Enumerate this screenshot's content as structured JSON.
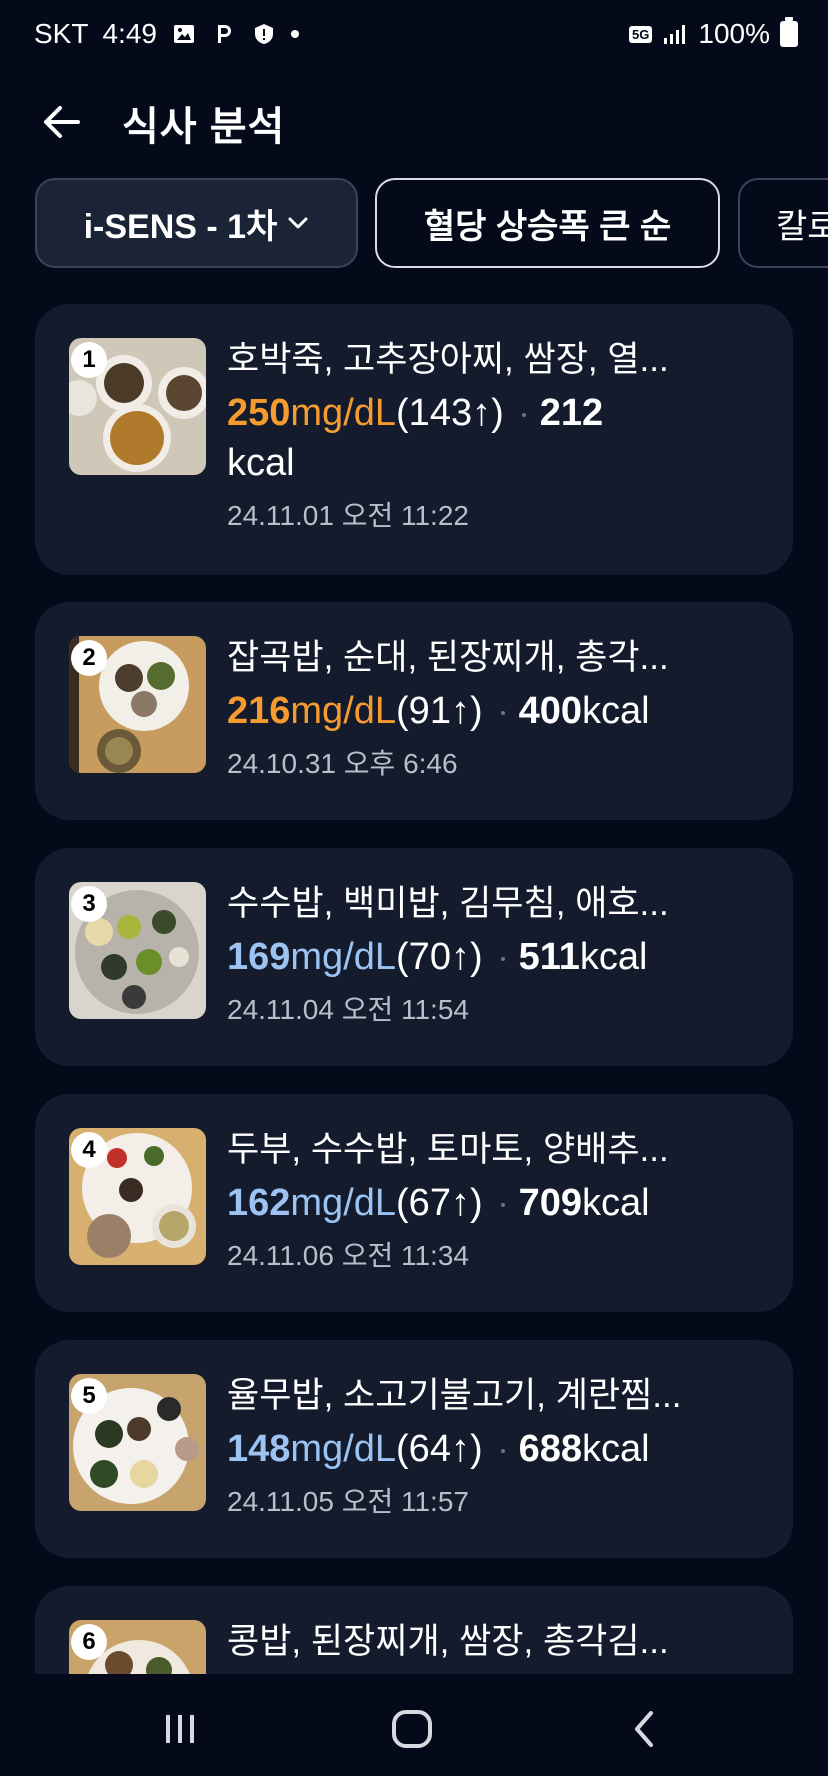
{
  "status": {
    "carrier": "SKT",
    "time": "4:49",
    "network": "5G",
    "battery": "100%",
    "icons": [
      "image-icon",
      "p-icon",
      "shield-icon",
      "dot-icon",
      "signal-icon",
      "battery-icon"
    ]
  },
  "header": {
    "title": "식사 분석"
  },
  "filters": {
    "device": "i-SENS - 1차",
    "sort": "혈당 상승폭 큰 순",
    "third": "칼로"
  },
  "colors": {
    "high": "#f59b2f",
    "normal": "#9cc3f2",
    "background": "#050a1b",
    "card": "#131b2c"
  },
  "meals": [
    {
      "rank": "1",
      "foods": "호박죽, 고추장아찌, 쌈장, 열...",
      "glucose": "250",
      "unit": "mg/dL",
      "rise": "(143↑)",
      "kcal": "212",
      "kcal_unit": "kcal",
      "date": "24.11.01 오전 11:22",
      "level": "high"
    },
    {
      "rank": "2",
      "foods": "잡곡밥, 순대, 된장찌개, 총각...",
      "glucose": "216",
      "unit": "mg/dL",
      "rise": "(91↑)",
      "kcal": "400",
      "kcal_unit": "kcal",
      "date": "24.10.31 오후 6:46",
      "level": "high"
    },
    {
      "rank": "3",
      "foods": "수수밥, 백미밥, 김무침, 애호...",
      "glucose": "169",
      "unit": "mg/dL",
      "rise": "(70↑)",
      "kcal": "511",
      "kcal_unit": "kcal",
      "date": "24.11.04 오전 11:54",
      "level": "normal"
    },
    {
      "rank": "4",
      "foods": "두부, 수수밥, 토마토, 양배추...",
      "glucose": "162",
      "unit": "mg/dL",
      "rise": "(67↑)",
      "kcal": "709",
      "kcal_unit": "kcal",
      "date": "24.11.06 오전 11:34",
      "level": "normal"
    },
    {
      "rank": "5",
      "foods": "율무밥, 소고기불고기, 계란찜...",
      "glucose": "148",
      "unit": "mg/dL",
      "rise": "(64↑)",
      "kcal": "688",
      "kcal_unit": "kcal",
      "date": "24.11.05 오전 11:57",
      "level": "normal"
    },
    {
      "rank": "6",
      "foods": "콩밥, 된장찌개, 쌈장, 총각김...",
      "glucose": "",
      "unit": "",
      "rise": "",
      "kcal": "",
      "kcal_unit": "",
      "date": "",
      "level": "normal"
    }
  ],
  "nav": {
    "icons": [
      "recent-apps-icon",
      "home-icon",
      "back-nav-icon"
    ]
  }
}
